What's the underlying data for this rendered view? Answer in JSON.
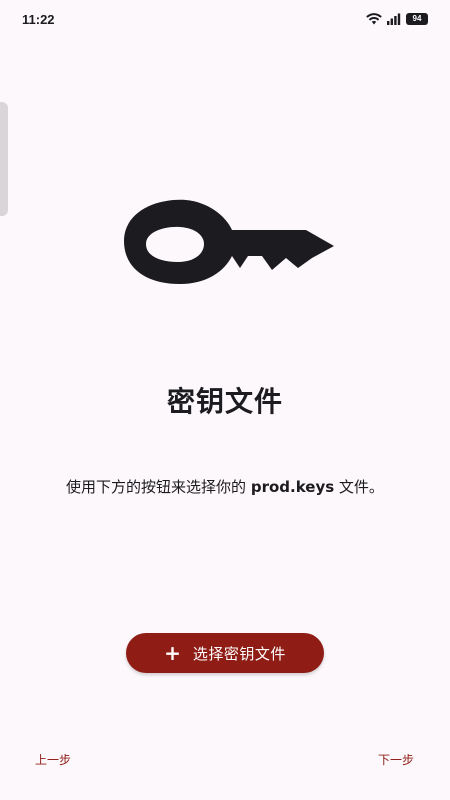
{
  "status_bar": {
    "time": "11:22",
    "battery_level": "94",
    "icons": [
      "wifi-icon",
      "signal-icon",
      "battery-icon"
    ]
  },
  "key_illustration": {
    "icon": "key-icon",
    "color": "#1c1b1f"
  },
  "title": "密钥文件",
  "description": {
    "prefix": "使用下方的按钮来选择你的 ",
    "filename": "prod.keys",
    "suffix": " 文件。"
  },
  "select_button": {
    "icon": "plus-icon",
    "icon_glyph": "+",
    "label": "选择密钥文件",
    "color": "#8f1d16"
  },
  "navigation": {
    "previous_label": "上一步",
    "next_label": "下一步"
  }
}
